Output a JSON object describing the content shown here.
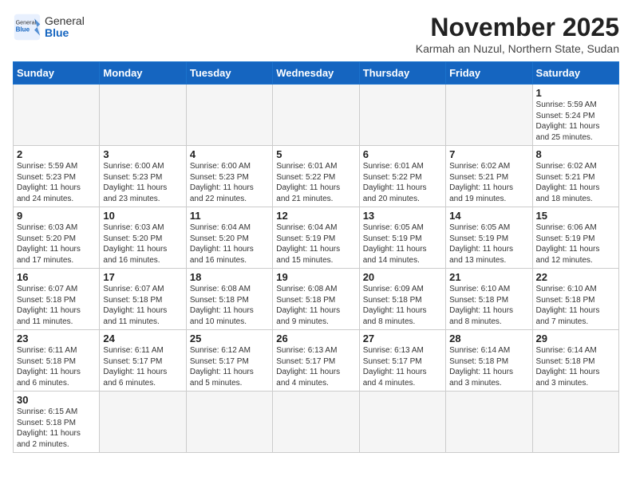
{
  "header": {
    "logo_general": "General",
    "logo_blue": "Blue",
    "month_title": "November 2025",
    "subtitle": "Karmah an Nuzul, Northern State, Sudan"
  },
  "days_of_week": [
    "Sunday",
    "Monday",
    "Tuesday",
    "Wednesday",
    "Thursday",
    "Friday",
    "Saturday"
  ],
  "weeks": [
    [
      {
        "day": null,
        "info": null
      },
      {
        "day": null,
        "info": null
      },
      {
        "day": null,
        "info": null
      },
      {
        "day": null,
        "info": null
      },
      {
        "day": null,
        "info": null
      },
      {
        "day": null,
        "info": null
      },
      {
        "day": "1",
        "info": "Sunrise: 5:59 AM\nSunset: 5:24 PM\nDaylight: 11 hours\nand 25 minutes."
      }
    ],
    [
      {
        "day": "2",
        "info": "Sunrise: 5:59 AM\nSunset: 5:23 PM\nDaylight: 11 hours\nand 24 minutes."
      },
      {
        "day": "3",
        "info": "Sunrise: 6:00 AM\nSunset: 5:23 PM\nDaylight: 11 hours\nand 23 minutes."
      },
      {
        "day": "4",
        "info": "Sunrise: 6:00 AM\nSunset: 5:23 PM\nDaylight: 11 hours\nand 22 minutes."
      },
      {
        "day": "5",
        "info": "Sunrise: 6:01 AM\nSunset: 5:22 PM\nDaylight: 11 hours\nand 21 minutes."
      },
      {
        "day": "6",
        "info": "Sunrise: 6:01 AM\nSunset: 5:22 PM\nDaylight: 11 hours\nand 20 minutes."
      },
      {
        "day": "7",
        "info": "Sunrise: 6:02 AM\nSunset: 5:21 PM\nDaylight: 11 hours\nand 19 minutes."
      },
      {
        "day": "8",
        "info": "Sunrise: 6:02 AM\nSunset: 5:21 PM\nDaylight: 11 hours\nand 18 minutes."
      }
    ],
    [
      {
        "day": "9",
        "info": "Sunrise: 6:03 AM\nSunset: 5:20 PM\nDaylight: 11 hours\nand 17 minutes."
      },
      {
        "day": "10",
        "info": "Sunrise: 6:03 AM\nSunset: 5:20 PM\nDaylight: 11 hours\nand 16 minutes."
      },
      {
        "day": "11",
        "info": "Sunrise: 6:04 AM\nSunset: 5:20 PM\nDaylight: 11 hours\nand 16 minutes."
      },
      {
        "day": "12",
        "info": "Sunrise: 6:04 AM\nSunset: 5:19 PM\nDaylight: 11 hours\nand 15 minutes."
      },
      {
        "day": "13",
        "info": "Sunrise: 6:05 AM\nSunset: 5:19 PM\nDaylight: 11 hours\nand 14 minutes."
      },
      {
        "day": "14",
        "info": "Sunrise: 6:05 AM\nSunset: 5:19 PM\nDaylight: 11 hours\nand 13 minutes."
      },
      {
        "day": "15",
        "info": "Sunrise: 6:06 AM\nSunset: 5:19 PM\nDaylight: 11 hours\nand 12 minutes."
      }
    ],
    [
      {
        "day": "16",
        "info": "Sunrise: 6:07 AM\nSunset: 5:18 PM\nDaylight: 11 hours\nand 11 minutes."
      },
      {
        "day": "17",
        "info": "Sunrise: 6:07 AM\nSunset: 5:18 PM\nDaylight: 11 hours\nand 11 minutes."
      },
      {
        "day": "18",
        "info": "Sunrise: 6:08 AM\nSunset: 5:18 PM\nDaylight: 11 hours\nand 10 minutes."
      },
      {
        "day": "19",
        "info": "Sunrise: 6:08 AM\nSunset: 5:18 PM\nDaylight: 11 hours\nand 9 minutes."
      },
      {
        "day": "20",
        "info": "Sunrise: 6:09 AM\nSunset: 5:18 PM\nDaylight: 11 hours\nand 8 minutes."
      },
      {
        "day": "21",
        "info": "Sunrise: 6:10 AM\nSunset: 5:18 PM\nDaylight: 11 hours\nand 8 minutes."
      },
      {
        "day": "22",
        "info": "Sunrise: 6:10 AM\nSunset: 5:18 PM\nDaylight: 11 hours\nand 7 minutes."
      }
    ],
    [
      {
        "day": "23",
        "info": "Sunrise: 6:11 AM\nSunset: 5:18 PM\nDaylight: 11 hours\nand 6 minutes."
      },
      {
        "day": "24",
        "info": "Sunrise: 6:11 AM\nSunset: 5:17 PM\nDaylight: 11 hours\nand 6 minutes."
      },
      {
        "day": "25",
        "info": "Sunrise: 6:12 AM\nSunset: 5:17 PM\nDaylight: 11 hours\nand 5 minutes."
      },
      {
        "day": "26",
        "info": "Sunrise: 6:13 AM\nSunset: 5:17 PM\nDaylight: 11 hours\nand 4 minutes."
      },
      {
        "day": "27",
        "info": "Sunrise: 6:13 AM\nSunset: 5:17 PM\nDaylight: 11 hours\nand 4 minutes."
      },
      {
        "day": "28",
        "info": "Sunrise: 6:14 AM\nSunset: 5:18 PM\nDaylight: 11 hours\nand 3 minutes."
      },
      {
        "day": "29",
        "info": "Sunrise: 6:14 AM\nSunset: 5:18 PM\nDaylight: 11 hours\nand 3 minutes."
      }
    ],
    [
      {
        "day": "30",
        "info": "Sunrise: 6:15 AM\nSunset: 5:18 PM\nDaylight: 11 hours\nand 2 minutes."
      },
      {
        "day": null,
        "info": null
      },
      {
        "day": null,
        "info": null
      },
      {
        "day": null,
        "info": null
      },
      {
        "day": null,
        "info": null
      },
      {
        "day": null,
        "info": null
      },
      {
        "day": null,
        "info": null
      }
    ]
  ]
}
